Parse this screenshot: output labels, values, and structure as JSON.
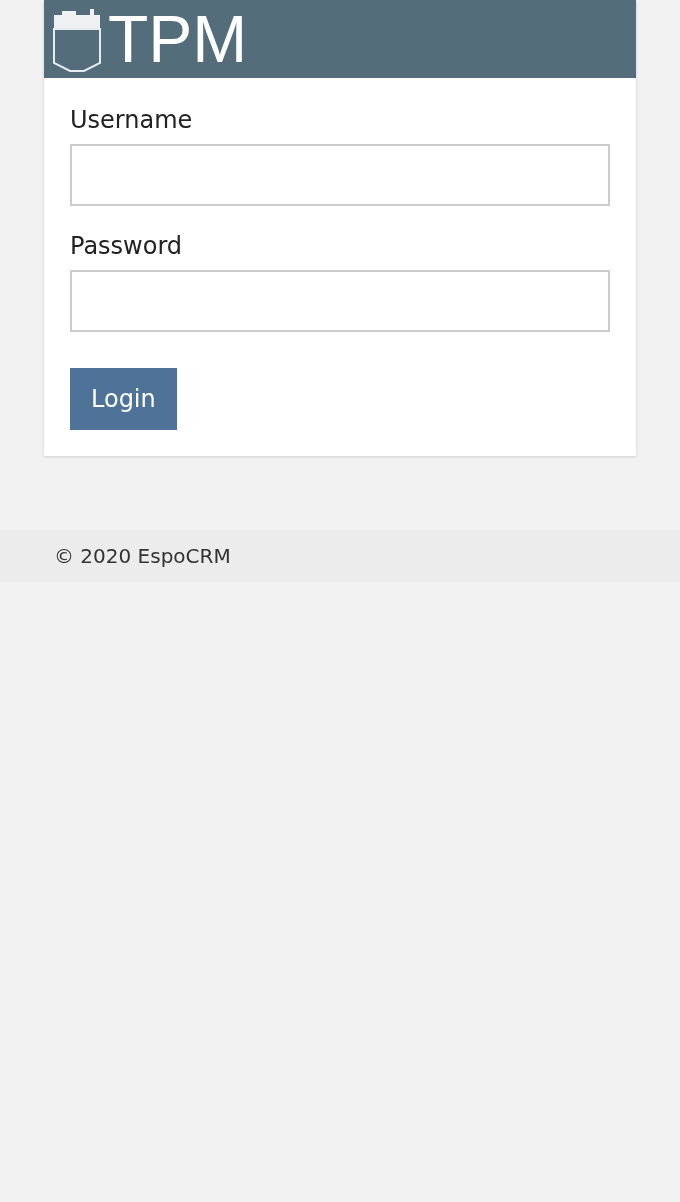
{
  "header": {
    "logo_text": "TPM"
  },
  "fields": [
    {
      "label": "Username"
    },
    {
      "label": "Password"
    }
  ],
  "login_button": "Login",
  "footer": "© 2020 EspoCRM"
}
